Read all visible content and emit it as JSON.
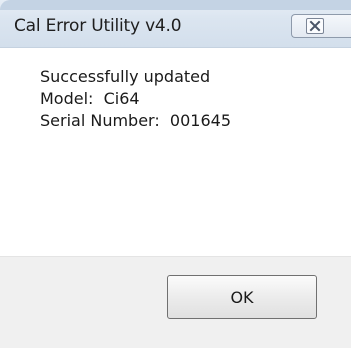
{
  "window": {
    "title": "Cal Error Utility v4.0",
    "close_icon": "close-icon"
  },
  "message": {
    "line1": "Successfully updated",
    "line2": "Model:  Ci64",
    "line3": "Serial Number:  001645"
  },
  "buttons": {
    "ok_label": "OK"
  },
  "colors": {
    "titlebar": "#dbe5f0",
    "footer": "#f0f0f0",
    "button_border": "#707070"
  }
}
